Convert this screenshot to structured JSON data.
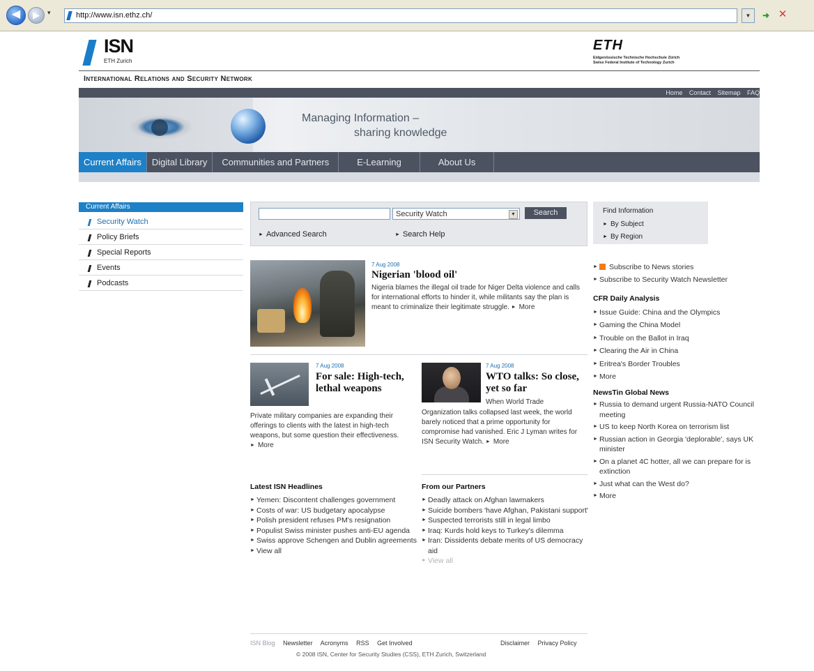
{
  "browser": {
    "url": "http://www.isn.ethz.ch/",
    "back_glyph": "◀",
    "forward_glyph": "▶",
    "history_glyph": "▾",
    "dropdown_glyph": "▼",
    "go_glyph": "➜",
    "stop_glyph": "✕"
  },
  "header": {
    "logo": "ISN",
    "logo_sub": "ETH Zurich",
    "eth_logo": "ETH",
    "eth_sub1": "Eidgenössische Technische Hochschule Zürich",
    "eth_sub2": "Swiss Federal Institute of Technology Zurich",
    "site_title": "International Relations and Security Network",
    "top_links": [
      "Home",
      "Contact",
      "Sitemap",
      "FAQ"
    ],
    "tagline_1": "Managing Information –",
    "tagline_2": "sharing knowledge"
  },
  "nav": {
    "tabs": [
      {
        "label": "Current Affairs"
      },
      {
        "label": "Digital Library"
      },
      {
        "label": "Communities and Partners"
      },
      {
        "label": "E-Learning"
      },
      {
        "label": "About Us"
      }
    ]
  },
  "left_nav": {
    "heading": "Current Affairs",
    "items": [
      {
        "label": "Security Watch"
      },
      {
        "label": "Policy Briefs"
      },
      {
        "label": "Special Reports"
      },
      {
        "label": "Events"
      },
      {
        "label": "Podcasts"
      }
    ]
  },
  "search": {
    "value": "",
    "selected": "Security Watch",
    "button": "Search",
    "advanced": "Advanced Search",
    "help": "Search Help"
  },
  "find": {
    "title": "Find Information",
    "by_subject": "By Subject",
    "by_region": "By Region"
  },
  "articles": {
    "main": {
      "date": "7 Aug 2008",
      "title": "Nigerian 'blood oil'",
      "body": "Nigeria blames the illegal oil trade for Niger Delta violence and calls for international efforts to hinder it, while militants say the plan is meant to criminalize their legitimate struggle.",
      "more": "More"
    },
    "second": {
      "date": "7 Aug 2008",
      "title": "For sale: High-tech, lethal weapons",
      "body": "Private military companies are expanding their offerings to clients with the latest in high-tech weapons, but some question their effectiveness.",
      "more": "More"
    },
    "third": {
      "date": "7 Aug 2008",
      "title": "WTO talks: So close, yet so far",
      "body_a": "When World Trade",
      "body_b": "Organization talks collapsed last week, the world barely noticed that a prime opportunity for compromise had vanished. Eric J Lyman writes for ISN Security Watch.",
      "more": "More"
    }
  },
  "latest": {
    "heading": "Latest ISN Headlines",
    "items": [
      "Yemen: Discontent challenges government",
      "Costs of war: US budgetary apocalypse",
      "Polish president refuses PM's resignation",
      "Populist Swiss minister pushes anti-EU agenda",
      "Swiss approve Schengen and Dublin agreements",
      "View all"
    ]
  },
  "partners": {
    "heading": "From our Partners",
    "items": [
      "Deadly attack on Afghan lawmakers",
      "Suicide bombers 'have Afghan, Pakistani support'",
      "Suspected terrorists still in legal limbo",
      "Iraq: Kurds hold keys to Turkey's dilemma",
      "Iran: Dissidents debate merits of US democracy aid",
      "View all"
    ]
  },
  "right": {
    "subscribe_news": "Subscribe to News stories",
    "subscribe_newsletter": "Subscribe to Security Watch Newsletter",
    "cfr_heading": "CFR Daily Analysis",
    "cfr_items": [
      "Issue Guide: China and the Olympics",
      "Gaming the China Model",
      "Trouble on the Ballot in Iraq",
      "Clearing the Air in China",
      "Eritrea's Border Troubles",
      "More"
    ],
    "newstin_heading": "NewsTin Global News",
    "newstin_items": [
      "Russia to demand urgent Russia-NATO Council meeting",
      "US to keep North Korea on terrorism list",
      "Russian action in Georgia 'deplorable', says UK minister",
      "On a planet 4C hotter, all we can prepare for is extinction",
      "Just what can the West do?",
      "More"
    ]
  },
  "footer": {
    "left_links": [
      "ISN Blog",
      "Newsletter",
      "Acronyms",
      "RSS",
      "Get Involved"
    ],
    "right_links": [
      "Disclaimer",
      "Privacy Policy"
    ],
    "copyright": "© 2008 ISN, Center for Security Studies (CSS), ETH Zurich, Switzerland"
  },
  "colors": {
    "accent": "#1e80c6",
    "nav_bg": "#4c5260",
    "panel_bg": "#e6e8ec"
  }
}
